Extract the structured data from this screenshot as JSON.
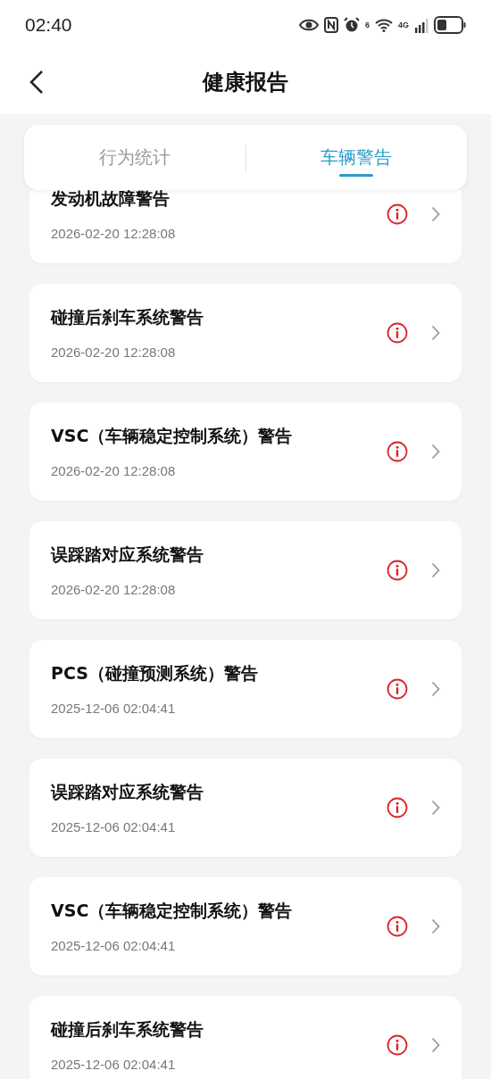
{
  "status_bar": {
    "time": "02:40",
    "network": "4G",
    "wifi_badge": "6"
  },
  "header": {
    "title": "健康报告"
  },
  "tabs": [
    {
      "label": "行为统计",
      "selected": false
    },
    {
      "label": "车辆警告",
      "selected": true
    }
  ],
  "warnings": [
    {
      "title": "发动机故障警告",
      "time": "2026-02-20 12:28:08"
    },
    {
      "title": "碰撞后刹车系统警告",
      "time": "2026-02-20 12:28:08"
    },
    {
      "title": "VSC（车辆稳定控制系统）警告",
      "time": "2026-02-20 12:28:08"
    },
    {
      "title": "误踩踏对应系统警告",
      "time": "2026-02-20 12:28:08"
    },
    {
      "title": "PCS（碰撞预测系统）警告",
      "time": "2025-12-06 02:04:41"
    },
    {
      "title": "误踩踏对应系统警告",
      "time": "2025-12-06 02:04:41"
    },
    {
      "title": "VSC（车辆稳定控制系统）警告",
      "time": "2025-12-06 02:04:41"
    },
    {
      "title": "碰撞后刹车系统警告",
      "time": "2025-12-06 02:04:41"
    }
  ]
}
